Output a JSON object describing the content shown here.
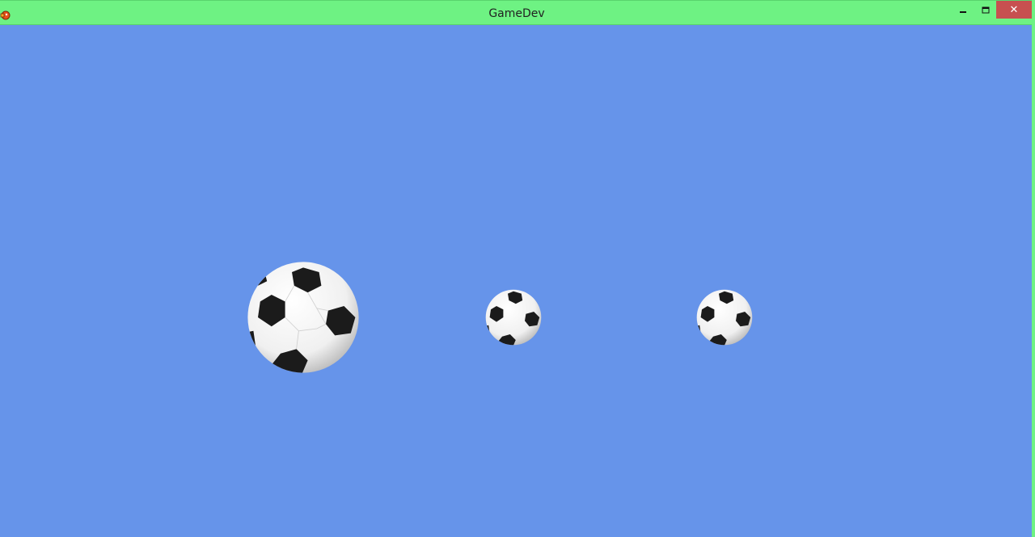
{
  "window": {
    "title": "GameDev",
    "close_glyph": "✕",
    "icons": {
      "app": "game-app-icon",
      "minimize": "minimize-icon",
      "maximize": "maximize-icon",
      "close": "close-icon"
    }
  },
  "scene": {
    "background_color": "#6694ea",
    "sprites": [
      "soccer-ball",
      "soccer-ball",
      "soccer-ball"
    ]
  }
}
